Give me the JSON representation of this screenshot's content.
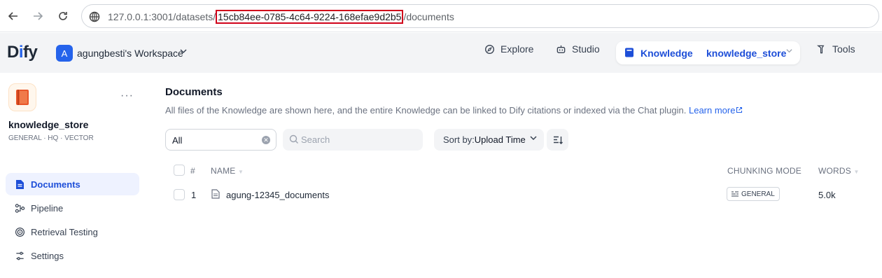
{
  "browser": {
    "url_prefix": "127.0.0.1:3001/datasets/",
    "url_highlight": "15cb84ee-0785-4c64-9224-168efae9d2b5",
    "url_suffix": "/documents"
  },
  "header": {
    "logo_pre": "D",
    "logo_accent": "i",
    "logo_post": "fy",
    "workspace_initial": "A",
    "workspace_name": "agungbesti's Workspace",
    "nav": {
      "explore": "Explore",
      "studio": "Studio",
      "knowledge": "Knowledge",
      "knowledge_store": "knowledge_store",
      "tools": "Tools"
    }
  },
  "sidebar": {
    "kb_name": "knowledge_store",
    "kb_meta": "GENERAL · HQ · VECTOR",
    "items": [
      {
        "label": "Documents",
        "icon": "document-icon",
        "active": true
      },
      {
        "label": "Pipeline",
        "icon": "pipeline-icon",
        "active": false
      },
      {
        "label": "Retrieval Testing",
        "icon": "target-icon",
        "active": false
      },
      {
        "label": "Settings",
        "icon": "gear-icon",
        "active": false
      }
    ]
  },
  "main": {
    "title": "Documents",
    "description": "All files of the Knowledge are shown here, and the entire Knowledge can be linked to Dify citations or indexed via the Chat plugin.",
    "learn_more": "Learn more",
    "filter_value": "All",
    "search_placeholder": "Search",
    "sort_label": "Sort by:",
    "sort_value": "Upload Time",
    "table": {
      "headers": {
        "num": "#",
        "name": "NAME",
        "mode": "CHUNKING MODE",
        "words": "WORDS"
      },
      "rows": [
        {
          "num": "1",
          "name": "agung-12345_documents",
          "mode": "GENERAL",
          "words": "5.0k"
        }
      ]
    }
  },
  "colors": {
    "accent": "#2563eb",
    "highlight_border": "#d0021b"
  }
}
